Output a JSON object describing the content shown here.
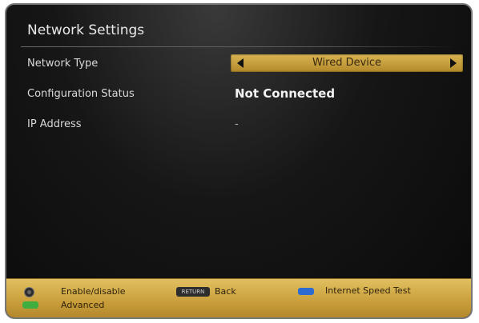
{
  "screen": {
    "title": "Network Settings"
  },
  "settings": {
    "network_type": {
      "label": "Network Type",
      "value": "Wired Device"
    },
    "configuration_status": {
      "label": "Configuration Status",
      "value": "Not Connected"
    },
    "ip_address": {
      "label": "IP Address",
      "value": "-"
    }
  },
  "footer": {
    "ok_label": "Enable/disable",
    "return_key_text": "RETURN",
    "back_label": "Back",
    "blue_label": "Internet Speed Test",
    "green_label": "Advanced"
  },
  "colors": {
    "accent": "#d9b452",
    "blue_key": "#2e6bd0",
    "green_key": "#3fae3f"
  }
}
